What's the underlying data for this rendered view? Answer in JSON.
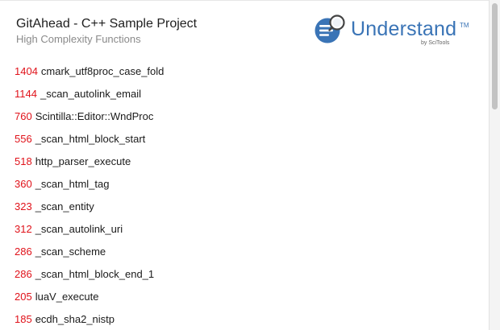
{
  "header": {
    "title": "GitAhead - C++ Sample Project",
    "subtitle": "High Complexity Functions"
  },
  "logo": {
    "word": "Understand",
    "trademark": "TM",
    "byline": "by SciTools",
    "icon": "understand-magnifier-icon",
    "color": "#3a74b6"
  },
  "accent_color": "#e0121a",
  "functions": [
    {
      "count": "1404",
      "name": "cmark_utf8proc_case_fold"
    },
    {
      "count": "1144",
      "name": "_scan_autolink_email"
    },
    {
      "count": "760",
      "name": "Scintilla::Editor::WndProc"
    },
    {
      "count": "556",
      "name": "_scan_html_block_start"
    },
    {
      "count": "518",
      "name": "http_parser_execute"
    },
    {
      "count": "360",
      "name": "_scan_html_tag"
    },
    {
      "count": "323",
      "name": "_scan_entity"
    },
    {
      "count": "312",
      "name": "_scan_autolink_uri"
    },
    {
      "count": "286",
      "name": "_scan_scheme"
    },
    {
      "count": "286",
      "name": "_scan_html_block_end_1"
    },
    {
      "count": "205",
      "name": "luaV_execute"
    },
    {
      "count": "185",
      "name": "ecdh_sha2_nistp"
    }
  ]
}
